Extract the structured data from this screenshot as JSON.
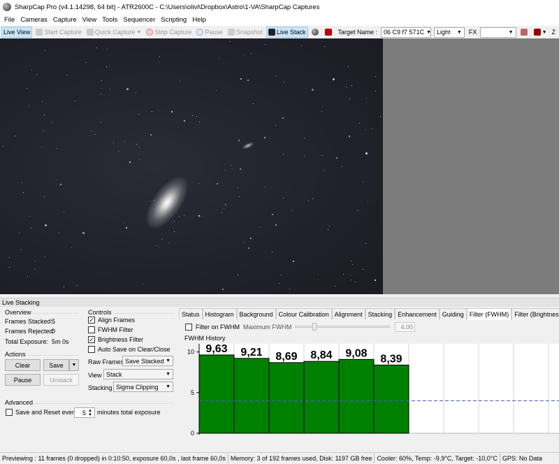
{
  "window": {
    "title": "SharpCap Pro (v4.1.14298, 64 bit) - ATR2600C - C:\\Users\\olivi\\Dropbox\\Astro\\1-VA\\SharpCap Captures"
  },
  "menu": [
    "File",
    "Cameras",
    "Capture",
    "View",
    "Tools",
    "Sequencer",
    "Scripting",
    "Help"
  ],
  "toolbar": {
    "live_view": "Live View",
    "start_capture": "Start Capture",
    "quick_capture": "Quick Capture",
    "stop_capture": "Stop Capture",
    "pause": "Pause",
    "snapshot": "Snapshot",
    "live_stack": "Live Stack",
    "target_name_label": "Target Name :",
    "target_name_value": "06 C9 f7 571C",
    "frame_type": "Light",
    "fx_label": "FX",
    "fx_value": "",
    "z_label": "Z"
  },
  "panel": {
    "title": "Live Stacking",
    "overview": {
      "heading": "Overview",
      "frames_stacked_label": "Frames Stacked:",
      "frames_stacked_value": "5",
      "frames_rejected_label": "Frames Rejected:",
      "frames_rejected_value": "0",
      "total_exposure_label": "Total Exposure:",
      "total_exposure_value": "5m 0s"
    },
    "actions": {
      "heading": "Actions",
      "clear": "Clear",
      "save": "Save",
      "pause": "Pause",
      "unstack": "Unstack"
    },
    "advanced": {
      "heading": "Advanced",
      "save_reset_label": "Save and Reset every",
      "save_reset_value": "5",
      "minutes_label": "minutes total exposure",
      "save_reset_checked": false
    },
    "controls": {
      "heading": "Controls",
      "align_frames": "Align Frames",
      "align_frames_checked": true,
      "fwhm_filter": "FWHM Filter",
      "fwhm_filter_checked": false,
      "brightness_filter": "Brightness Filter",
      "brightness_filter_checked": true,
      "auto_save": "Auto Save on Clear/Close",
      "auto_save_checked": false,
      "raw_frames_label": "Raw Frames",
      "raw_frames_value": "Save Stacked",
      "view_label": "View",
      "view_value": "Stack",
      "stacking_label": "Stacking",
      "stacking_value": "Sigma Clipping"
    },
    "tabs": [
      "Status",
      "Histogram",
      "Background",
      "Colour Calibration",
      "Alignment",
      "Stacking",
      "Enhancement",
      "Guiding",
      "Filter (FWHM)",
      "Filter (Brightness)"
    ],
    "selected_tab": "Filter (FWHM)",
    "filter": {
      "filter_on_fwhm_label": "Filter on FWHM",
      "filter_on_fwhm_checked": false,
      "max_fwhm_label": "Maximum FWHM",
      "max_fwhm_value": "4.00",
      "history_label": "FWHM History"
    }
  },
  "chart_data": {
    "type": "bar",
    "values": [
      9.63,
      9.21,
      8.69,
      8.84,
      9.08,
      8.39
    ],
    "labels": [
      "9,63",
      "9,21",
      "8,69",
      "8,84",
      "9,08",
      "8,39"
    ],
    "ytick_labels": [
      "0",
      "5",
      "10"
    ],
    "ylim": [
      0,
      11
    ],
    "threshold": 4.0,
    "empty_slots": 4,
    "bar_color": "#008000",
    "threshold_color": "#4a5fc1"
  },
  "statusbar": {
    "previewing": "Previewing : 11 frames (0 dropped) in 0:10:50, exposure 60,0s , last frame 60,0s",
    "memory": "Memory: 3 of 192 frames used, Disk: 1197 GB free",
    "cooler": "Cooler: 60%, Temp: -9,9°C, Target: -10,0°C",
    "gps": "GPS: No Data"
  }
}
